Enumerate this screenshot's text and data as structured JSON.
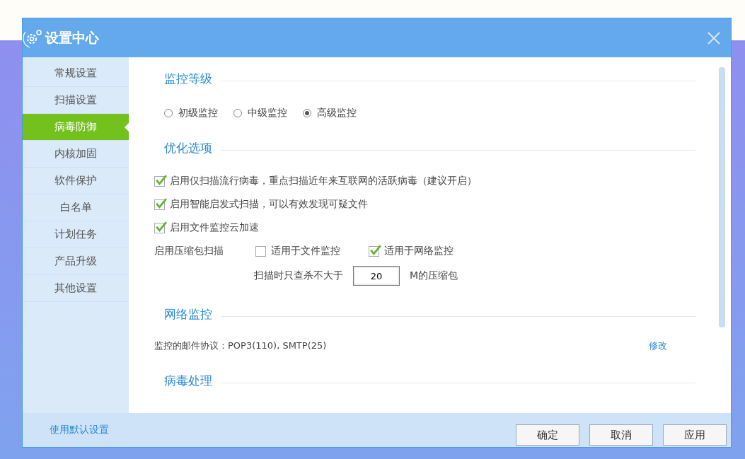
{
  "window": {
    "title": "设置中心"
  },
  "sidebar": {
    "items": [
      {
        "label": "常规设置",
        "selected": false
      },
      {
        "label": "扫描设置",
        "selected": false
      },
      {
        "label": "病毒防御",
        "selected": true
      },
      {
        "label": "内核加固",
        "selected": false
      },
      {
        "label": "软件保护",
        "selected": false
      },
      {
        "label": "白名单",
        "selected": false
      },
      {
        "label": "计划任务",
        "selected": false
      },
      {
        "label": "产品升级",
        "selected": false
      },
      {
        "label": "其他设置",
        "selected": false
      }
    ]
  },
  "sections": [
    {
      "title": "监控等级",
      "kind": "radios",
      "options": [
        {
          "label": "初级监控",
          "selected": false
        },
        {
          "label": "中级监控",
          "selected": false
        },
        {
          "label": "高级监控",
          "selected": true
        }
      ]
    },
    {
      "title": "优化选项",
      "kind": "checks",
      "items": [
        {
          "label": "启用仅扫描流行病毒，重点扫描近年来互联网的活跃病毒（建议开启）",
          "checked": true
        },
        {
          "label": "启用智能启发式扫描，可以有效发现可疑文件",
          "checked": true
        },
        {
          "label": "启用文件监控云加速",
          "checked": true
        }
      ],
      "archive": {
        "label": "启用压缩包扫描",
        "options": [
          {
            "label": "适用于文件监控",
            "checked": false
          },
          {
            "label": "适用于网络监控",
            "checked": true
          }
        ],
        "limit": {
          "prefix": "扫描时只查杀不大于",
          "value": "20",
          "suffix": "M的压缩包"
        }
      }
    },
    {
      "title": "网络监控",
      "kind": "network",
      "text": "监控的邮件协议：POP3(110), SMTP(25)",
      "action": "修改"
    },
    {
      "title": "病毒处理",
      "kind": "plain"
    }
  ],
  "footer": {
    "link": "使用默认设置",
    "buttons": [
      "确定",
      "取消",
      "应用"
    ]
  }
}
